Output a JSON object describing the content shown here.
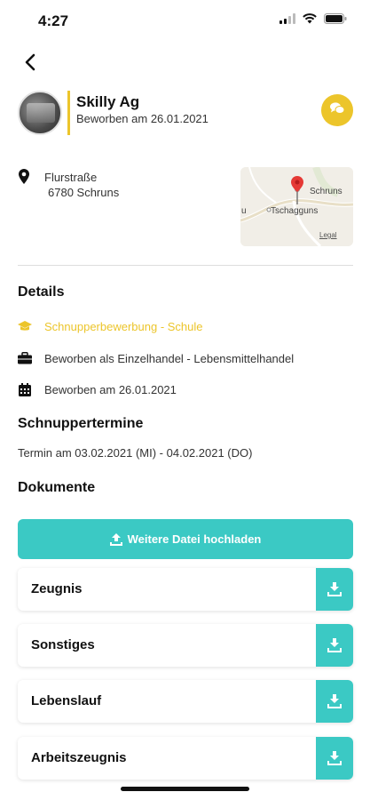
{
  "status_bar": {
    "time": "4:27"
  },
  "header": {
    "company_name": "Skilly Ag",
    "applied_date": "Beworben am 26.01.2021"
  },
  "address": {
    "street": "Flurstraße",
    "city": "6780 Schruns"
  },
  "map": {
    "labels": [
      "Schruns",
      "Tschagguns",
      "u",
      "Legal"
    ]
  },
  "details": {
    "title": "Details",
    "items": [
      {
        "icon": "graduation-cap-icon",
        "text": "Schnupperbewerbung - Schule",
        "highlight": true
      },
      {
        "icon": "briefcase-icon",
        "text": "Beworben als Einzelhandel - Lebensmittelhandel",
        "highlight": false
      },
      {
        "icon": "calendar-icon",
        "text": "Beworben am 26.01.2021",
        "highlight": false
      }
    ]
  },
  "schnuppertermine": {
    "title": "Schnuppertermine",
    "termin": "Termin am 03.02.2021 (MI) - 04.02.2021 (DO)"
  },
  "dokumente": {
    "title": "Dokumente",
    "upload_label": "Weitere Datei hochladen",
    "items": [
      "Zeugnis",
      "Sonstiges",
      "Lebenslauf",
      "Arbeitszeugnis"
    ]
  },
  "colors": {
    "accent_yellow": "#ecc52b",
    "accent_teal": "#3bc9c4"
  }
}
